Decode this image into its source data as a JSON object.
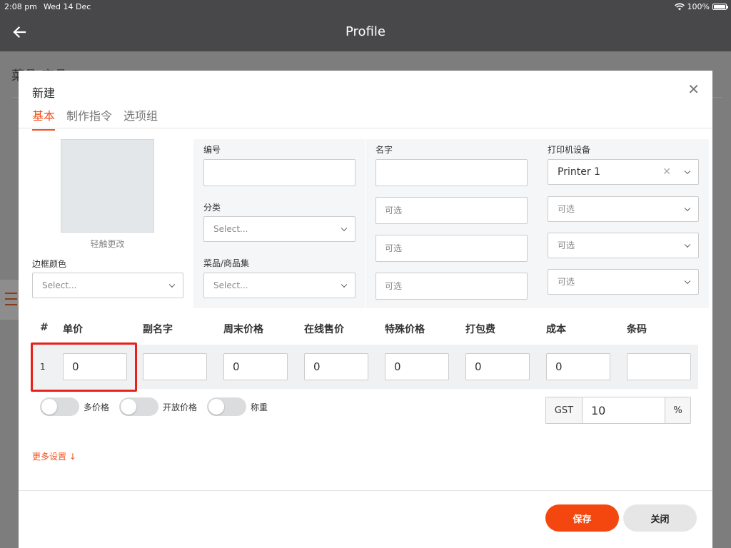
{
  "status_bar": {
    "time": "2:08 pm",
    "date": "Wed 14 Dec",
    "battery": "100%"
  },
  "header": {
    "title": "Profile",
    "back_icon": "arrow-left-icon"
  },
  "background_page": {
    "title": "菜品/商品"
  },
  "modal": {
    "title": "新建",
    "close_icon": "close-icon",
    "tabs": [
      {
        "label": "基本",
        "active": true
      },
      {
        "label": "制作指令",
        "active": false
      },
      {
        "label": "选项组",
        "active": false
      }
    ],
    "image_hint": "轻触更改",
    "border_color": {
      "label": "边框颜色",
      "placeholder": "Select..."
    },
    "code": {
      "label": "编号",
      "value": ""
    },
    "category": {
      "label": "分类",
      "placeholder": "Select..."
    },
    "item_set": {
      "label": "菜品/商品集",
      "placeholder": "Select..."
    },
    "name": {
      "label": "名字",
      "value": "",
      "optional_fields": [
        "可选",
        "可选",
        "可选"
      ]
    },
    "printer": {
      "label": "打印机设备",
      "selected": "Printer 1",
      "optional_selects": [
        "可选",
        "可选",
        "可选"
      ]
    },
    "price_table": {
      "columns": [
        "#",
        "单价",
        "副名字",
        "周末价格",
        "在线售价",
        "特殊价格",
        "打包费",
        "成本",
        "条码"
      ],
      "rows": [
        {
          "num": "1",
          "unit_price": "0",
          "subname": "",
          "weekend_price": "0",
          "online_price": "0",
          "special_price": "0",
          "packing_fee": "0",
          "cost": "0",
          "barcode": ""
        }
      ]
    },
    "toggles": [
      {
        "label": "多价格",
        "on": false
      },
      {
        "label": "开放价格",
        "on": false
      },
      {
        "label": "称重",
        "on": false
      }
    ],
    "gst": {
      "label": "GST",
      "value": "10",
      "unit": "%"
    },
    "more_settings": "更多设置 ↓",
    "buttons": {
      "save": "保存",
      "close": "关闭"
    },
    "colors": {
      "accent": "#f4511e",
      "save_button": "#f4470f",
      "highlight": "#e8201a"
    }
  }
}
